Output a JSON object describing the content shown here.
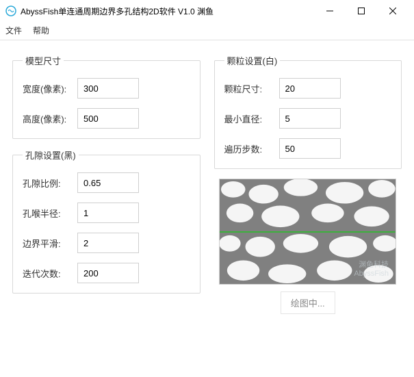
{
  "window": {
    "title": "AbyssFish单连通周期边界多孔结构2D软件 V1.0 渊鱼"
  },
  "menu": {
    "file": "文件",
    "help": "帮助"
  },
  "model_size": {
    "legend": "模型尺寸",
    "width_label": "宽度(像素):",
    "width_value": "300",
    "height_label": "高度(像素):",
    "height_value": "500"
  },
  "pore_settings": {
    "legend": "孔隙设置(黑)",
    "ratio_label": "孔隙比例:",
    "ratio_value": "0.65",
    "throat_label": "孔喉半径:",
    "throat_value": "1",
    "smooth_label": "边界平滑:",
    "smooth_value": "2",
    "iter_label": "迭代次数:",
    "iter_value": "200"
  },
  "particle_settings": {
    "legend": "颗粒设置(白)",
    "size_label": "颗粒尺寸:",
    "size_value": "20",
    "min_diam_label": "最小直径:",
    "min_diam_value": "5",
    "steps_label": "遍历步数:",
    "steps_value": "50"
  },
  "preview": {
    "watermark_line1": "渊鱼科技",
    "watermark_line2": "AbyssFish"
  },
  "status": {
    "drawing": "绘图中..."
  }
}
